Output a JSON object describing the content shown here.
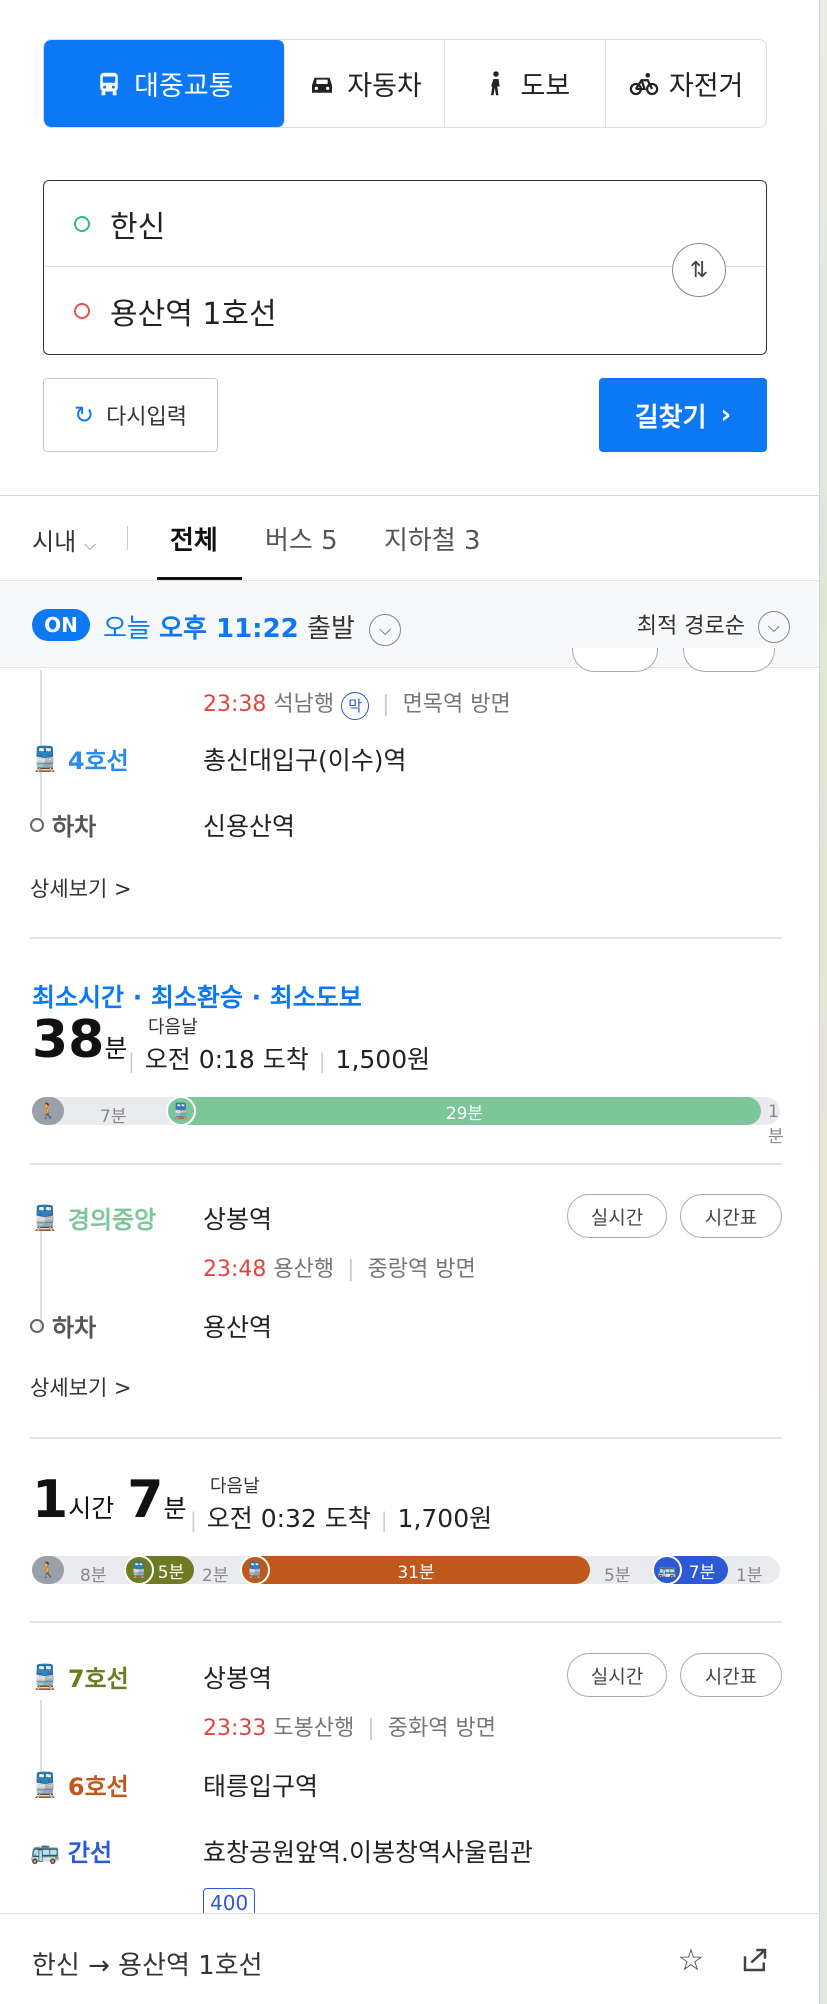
{
  "modes": [
    {
      "label": "대중교통",
      "icon": "bus-icon",
      "active": true
    },
    {
      "label": "자동차",
      "icon": "car-icon",
      "active": false
    },
    {
      "label": "도보",
      "icon": "walk-icon",
      "active": false
    },
    {
      "label": "자전거",
      "icon": "bike-icon",
      "active": false
    }
  ],
  "route": {
    "origin": "한신",
    "destination": "용산역 1호선"
  },
  "buttons": {
    "reset": "다시입력",
    "find": "길찾기"
  },
  "filters": {
    "region": "시내",
    "tabs": [
      "전체",
      "버스 5",
      "지하철 3"
    ]
  },
  "depart": {
    "on": "ON",
    "prefix": "오늘",
    "time": "오후 11:22",
    "suffix": "출발",
    "sort": "최적 경로순"
  },
  "route1_tail": {
    "sub": {
      "time": "23:38",
      "dest": "석남행",
      "badge": "막",
      "dir": "면목역 방면"
    },
    "line": {
      "name": "4호선",
      "station": "총신대입구(이수)역",
      "color": "#2b8be8"
    },
    "alight": {
      "label": "하차",
      "station": "신용산역"
    },
    "more": "상세보기 >"
  },
  "route2": {
    "tags": "최소시간 · 최소환승 · 최소도보",
    "minutes": "38",
    "unit": "분",
    "next_day": "다음날",
    "arrive": "오전 0:18 도착",
    "fare": "1,500원",
    "bar": {
      "walk1": "7분",
      "ride": "29분",
      "walk2": "1분",
      "ride_color": "#7dc69a"
    },
    "line": {
      "name": "경의중앙",
      "station": "상봉역",
      "color": "#7dc69a",
      "realtime": "실시간",
      "timetable": "시간표"
    },
    "sub": {
      "time": "23:48",
      "dest": "용산행",
      "dir": "중랑역 방면"
    },
    "alight": {
      "label": "하차",
      "station": "용산역"
    },
    "more": "상세보기 >"
  },
  "route3": {
    "hours": "1",
    "hour_unit": "시간",
    "minutes": "7",
    "unit": "분",
    "next_day": "다음날",
    "arrive": "오전 0:32 도착",
    "fare": "1,700원",
    "bar": {
      "walk1": "8분",
      "ride1": "5분",
      "walk2": "2분",
      "ride2": "31분",
      "walk3": "5분",
      "ride3": "7분",
      "walk4": "1분",
      "ride1_color": "#6f7b22",
      "ride2_color": "#c0571b",
      "ride3_color": "#2b59d8"
    },
    "line1": {
      "name": "7호선",
      "station": "상봉역",
      "color": "#6f7b22",
      "realtime": "실시간",
      "timetable": "시간표"
    },
    "sub": {
      "time": "23:33",
      "dest": "도봉산행",
      "dir": "중화역 방면"
    },
    "line2": {
      "name": "6호선",
      "station": "태릉입구역",
      "color": "#c0571b"
    },
    "line3": {
      "name": "간선",
      "station": "효창공원앞역.이봉창역사울림관",
      "color": "#2b59d8",
      "bus_no": "400"
    }
  },
  "bottom": {
    "title": "한신 → 용산역 1호선"
  }
}
